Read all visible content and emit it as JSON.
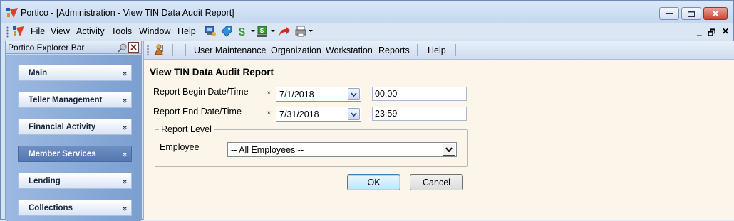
{
  "window": {
    "title": "Portico - [Administration - View TIN Data Audit Report]",
    "min_glyph": "—",
    "max_glyph": "□",
    "close_glyph": "✕"
  },
  "menubar": {
    "items": [
      "File",
      "View",
      "Activity",
      "Tools",
      "Window",
      "Help"
    ],
    "mdi_min": "_",
    "mdi_restore": "🗗",
    "mdi_close": "✕"
  },
  "explorer": {
    "title": "Portico Explorer Bar",
    "close_glyph": "✕",
    "sections": [
      {
        "label": "Main",
        "chevron": "»",
        "active": false
      },
      {
        "label": "Teller Management",
        "chevron": "»",
        "active": false
      },
      {
        "label": "Financial Activity",
        "chevron": "»",
        "active": false
      },
      {
        "label": "Member Services",
        "chevron": "»",
        "active": true
      },
      {
        "label": "Lending",
        "chevron": "»",
        "active": false
      },
      {
        "label": "Collections",
        "chevron": "»",
        "active": false
      }
    ]
  },
  "subbar": {
    "items": [
      "User Maintenance",
      "Organization",
      "Workstation",
      "Reports",
      "Help"
    ]
  },
  "form": {
    "title": "View TIN Data Audit Report",
    "begin_label": "Report Begin Date/Time",
    "end_label": "Report End Date/Time",
    "required_mark": "*",
    "begin_date": "7/1/2018",
    "begin_time": "00:00",
    "end_date": "7/31/2018",
    "end_time": "23:59",
    "group_label": "Report Level",
    "employee_label": "Employee",
    "employee_value": "-- All Employees --",
    "ok": "OK",
    "cancel": "Cancel"
  },
  "colors": {
    "active_section": "#5a7db5",
    "content_bg": "#fbf6e9",
    "window_bg": "#d6e3f3"
  }
}
